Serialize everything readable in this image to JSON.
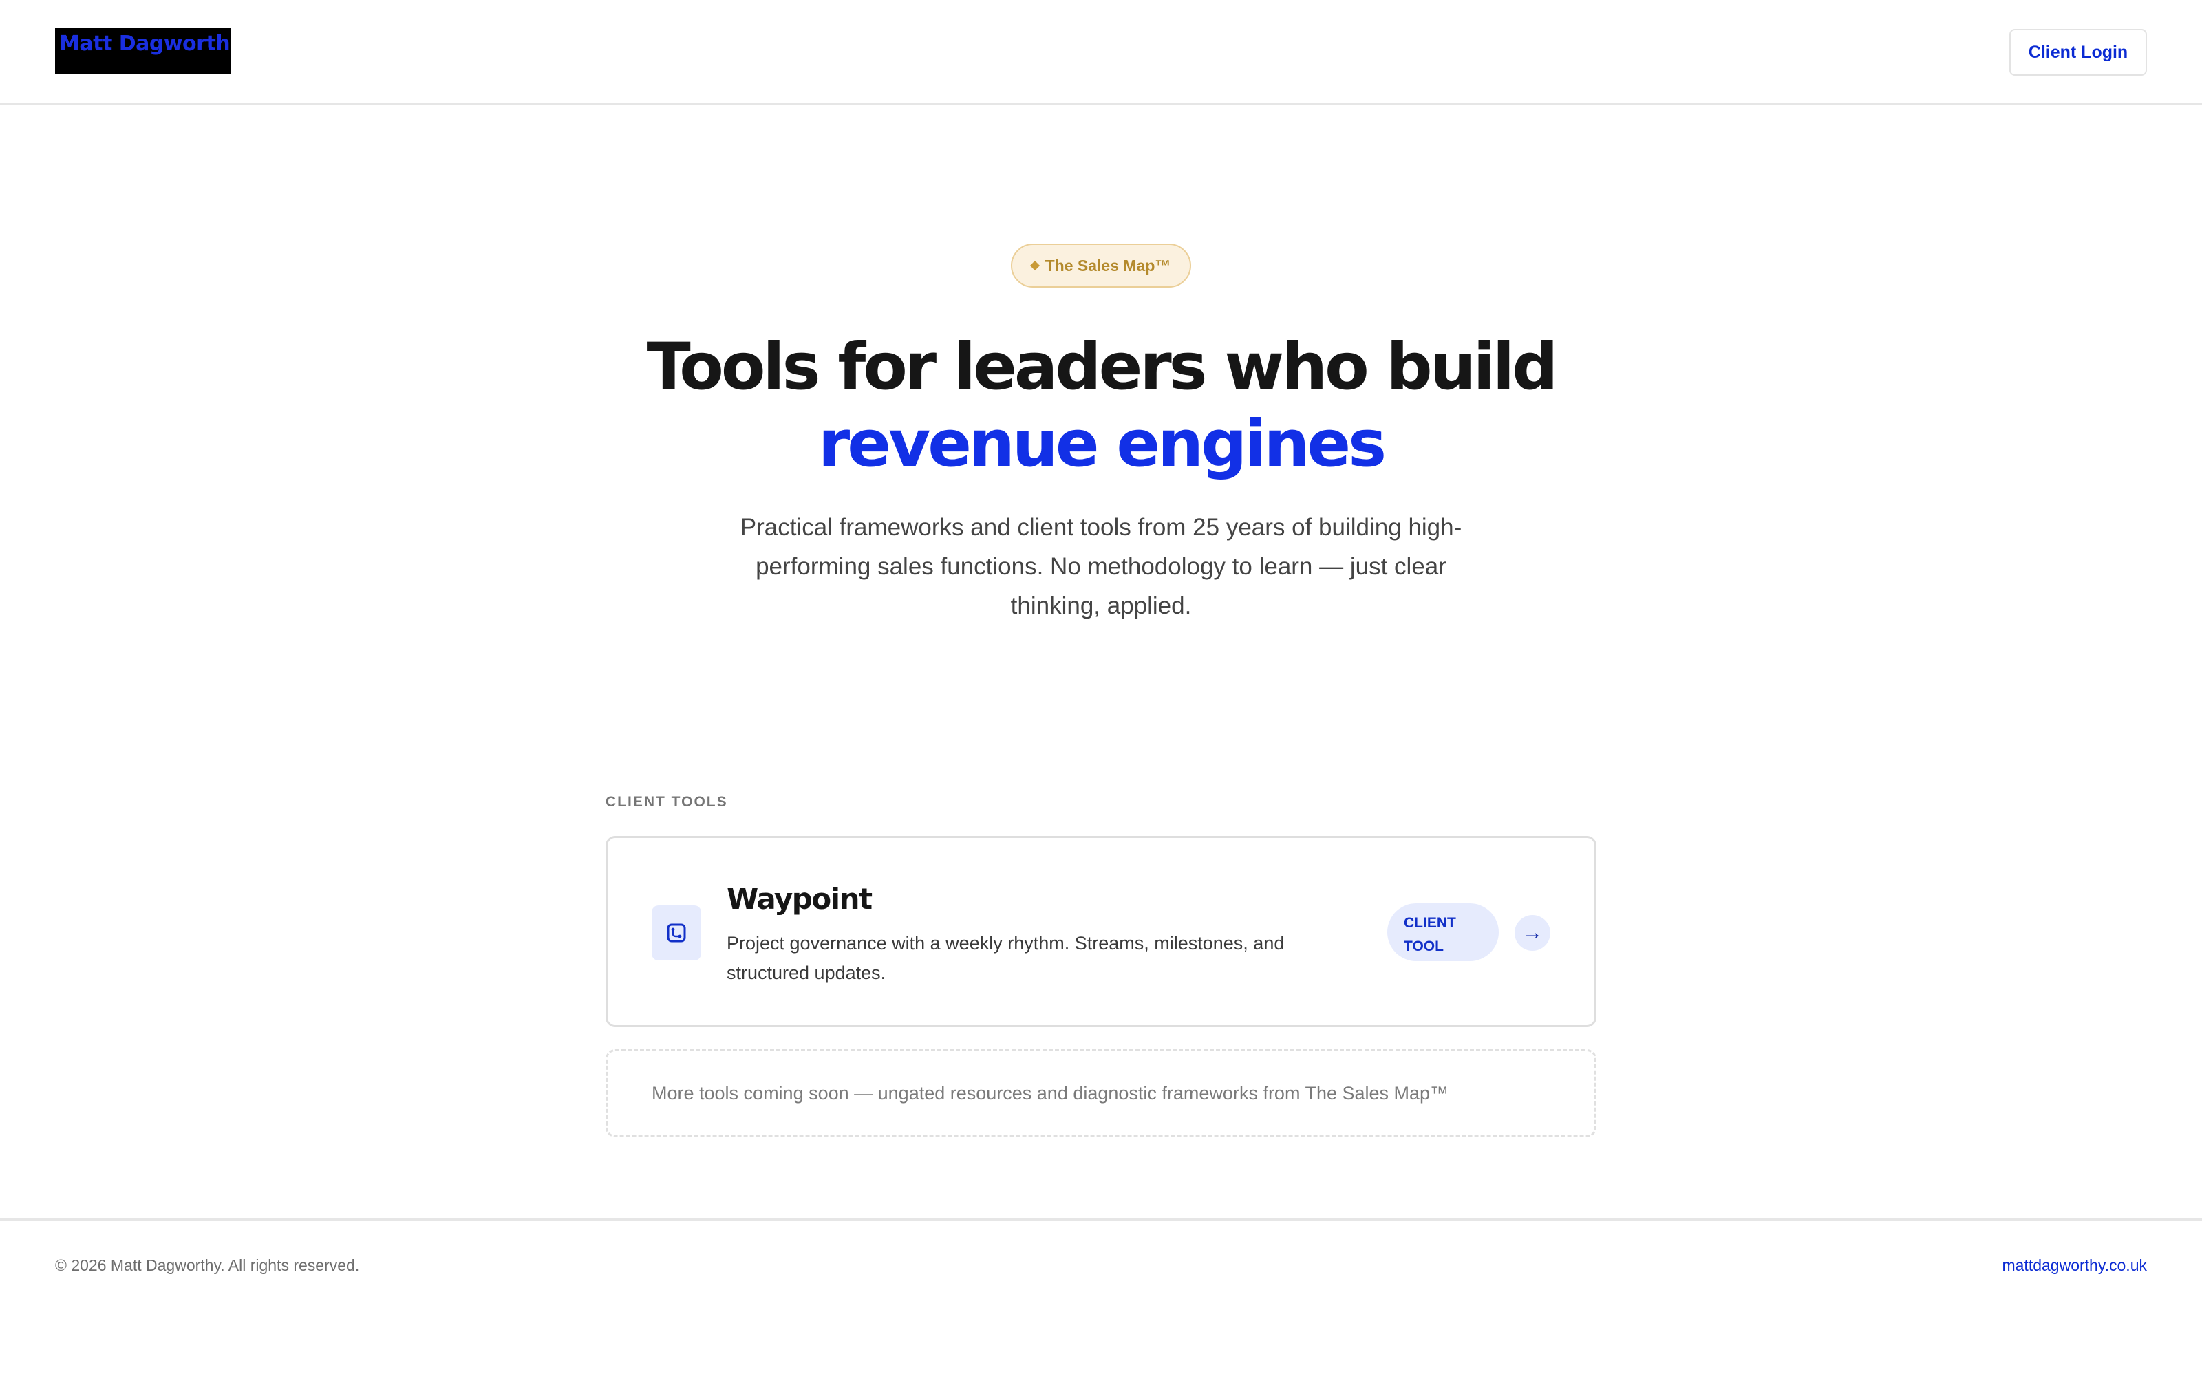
{
  "header": {
    "logo_text": "Matt Dagworthy",
    "login_label": "Client Login"
  },
  "hero": {
    "badge_label": "The Sales Map™",
    "headline_line1": "Tools for leaders who build",
    "headline_line2": "revenue engines",
    "subtitle": "Practical frameworks and client tools from 25 years of building high-performing sales functions. No methodology to learn — just clear thinking, applied."
  },
  "client_tools": {
    "section_label": "CLIENT TOOLS",
    "tools": [
      {
        "name": "Waypoint",
        "description": "Project governance with a weekly rhythm. Streams, milestones, and structured updates.",
        "badge_line1": "CLIENT",
        "badge_line2": "TOOL",
        "icon": "waypoint-icon",
        "arrow_icon": "arrow-right-icon"
      }
    ],
    "coming_soon_text": "More tools coming soon — ungated resources and diagnostic frameworks from The Sales Map™"
  },
  "footer": {
    "copyright": "© 2026 Matt Dagworthy. All rights reserved.",
    "site_link": "mattdagworthy.co.uk"
  },
  "colors": {
    "accent": "#1230e6",
    "badge_gold": "#b48a2c",
    "badge_bg": "#fbf1df",
    "tool_tint": "#e6ebfd"
  }
}
